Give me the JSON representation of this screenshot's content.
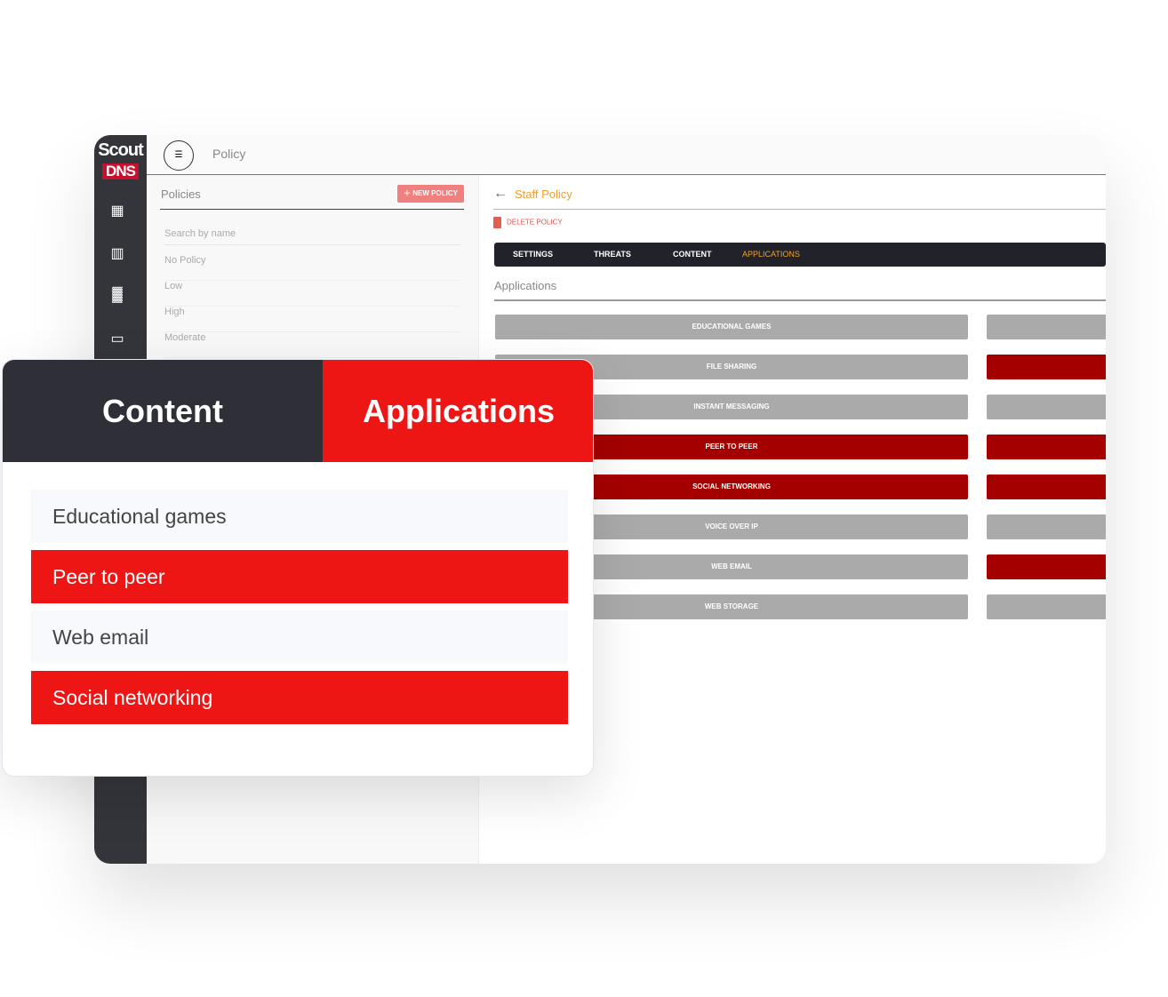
{
  "app": {
    "logo_top": "Scout",
    "logo_bottom": "DNS",
    "title": "Policy"
  },
  "sidebar": {
    "icons": [
      "dashboard-icon",
      "chart-icon",
      "building-icon",
      "devices-icon"
    ]
  },
  "policies": {
    "title": "Policies",
    "new_label": "NEW POLICY",
    "search_placeholder": "Search by name",
    "items": [
      "No Policy",
      "Low",
      "High",
      "Moderate"
    ]
  },
  "detail": {
    "title": "Staff Policy",
    "delete_label": "DELETE POLICY",
    "tabs": [
      "SETTINGS",
      "THREATS",
      "CONTENT",
      "APPLICATIONS"
    ],
    "active_tab": "APPLICATIONS",
    "section": "Applications",
    "apps": [
      {
        "label": "EDUCATIONAL GAMES",
        "blocked": false,
        "second_blocked": false
      },
      {
        "label": "FILE SHARING",
        "blocked": false,
        "second_blocked": true
      },
      {
        "label": "INSTANT MESSAGING",
        "blocked": false,
        "second_blocked": false
      },
      {
        "label": "PEER TO PEER",
        "blocked": true,
        "second_blocked": true
      },
      {
        "label": "SOCIAL NETWORKING",
        "blocked": true,
        "second_blocked": true
      },
      {
        "label": "VOICE OVER IP",
        "blocked": false,
        "second_blocked": false
      },
      {
        "label": "WEB EMAIL",
        "blocked": false,
        "second_blocked": true
      },
      {
        "label": "WEB STORAGE",
        "blocked": false,
        "second_blocked": false
      }
    ]
  },
  "card": {
    "tab_content": "Content",
    "tab_applications": "Applications",
    "items": [
      {
        "label": "Educational games",
        "blocked": false
      },
      {
        "label": "Peer to peer",
        "blocked": true
      },
      {
        "label": "Web email",
        "blocked": false
      },
      {
        "label": "Social networking",
        "blocked": true
      }
    ]
  },
  "colors": {
    "blocked": "#a50000",
    "allowed": "#aaaaaa",
    "card_red": "#ee1515",
    "dark": "#2f3037",
    "accent": "#f0a030"
  }
}
